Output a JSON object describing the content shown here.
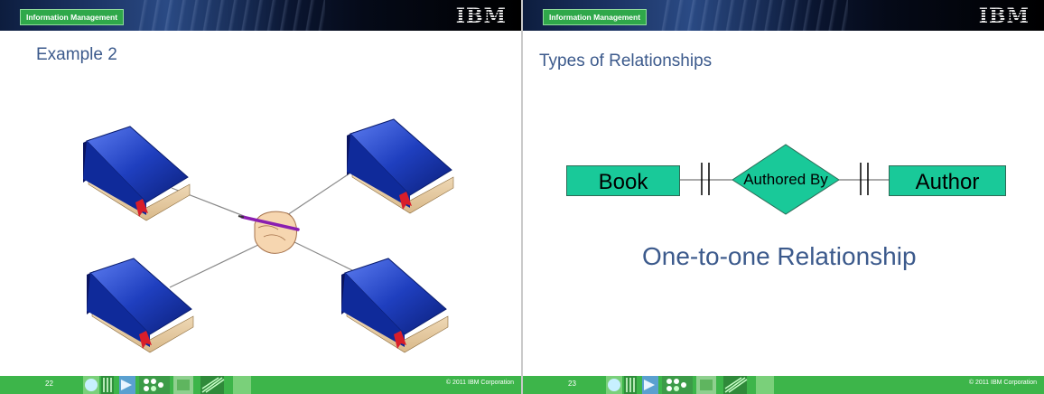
{
  "slides": [
    {
      "brand_tag": "Information Management",
      "logo": "IBM",
      "title": "Example 2",
      "page_number": "22",
      "copyright": "© 2011  IBM Corporation"
    },
    {
      "brand_tag": "Information Management",
      "logo": "IBM",
      "title": "Types of Relationships",
      "page_number": "23",
      "copyright": "© 2011  IBM Corporation",
      "diagram": {
        "entity_left": "Book",
        "relationship": "Authored By",
        "entity_right": "Author",
        "caption": "One-to-one Relationship"
      }
    }
  ],
  "icons": [
    "book-icon",
    "writing-hand-icon"
  ],
  "colors": {
    "title_blue": "#3c5a8c",
    "footer_green": "#3db54a",
    "entity_green": "#19c999",
    "book_blue": "#1f3fbf",
    "ribbon_red": "#d81e2a"
  }
}
